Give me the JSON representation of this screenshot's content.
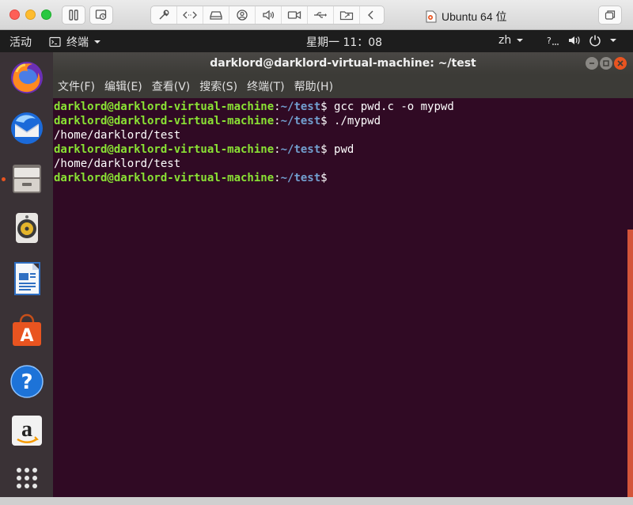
{
  "host": {
    "vm_name": "Ubuntu 64 位",
    "toolbar_icons": [
      "wrench-icon",
      "code-arrows-icon",
      "drive-icon",
      "user-camera-icon",
      "speaker-icon",
      "camera-icon",
      "usb-icon",
      "folder-share-icon",
      "collapse-icon"
    ]
  },
  "topbar": {
    "activities": "活动",
    "app_menu": "终端",
    "clock": "星期一 11：08",
    "input_method": "zh"
  },
  "dock": {
    "apps": [
      "firefox-icon",
      "thunderbird-icon",
      "files-icon",
      "rhythmbox-icon",
      "writer-icon",
      "software-icon",
      "help-icon",
      "amazon-icon",
      "app-grid-icon"
    ]
  },
  "terminal": {
    "title": "darklord@darklord-virtual-machine: ~/test",
    "menus": [
      "文件(F)",
      "编辑(E)",
      "查看(V)",
      "搜索(S)",
      "终端(T)",
      "帮助(H)"
    ],
    "lines": [
      {
        "user": "darklord@darklord-virtual-machine",
        "path": "~/test",
        "cmd": " gcc pwd.c -o mypwd"
      },
      {
        "user": "darklord@darklord-virtual-machine",
        "path": "~/test",
        "cmd": " ./mypwd"
      },
      {
        "output": "/home/darklord/test"
      },
      {
        "user": "darklord@darklord-virtual-machine",
        "path": "~/test",
        "cmd": " pwd"
      },
      {
        "output": "/home/darklord/test"
      },
      {
        "user": "darklord@darklord-virtual-machine",
        "path": "~/test",
        "cmd": ""
      }
    ]
  },
  "colors": {
    "terminal_bg": "#300a24",
    "prompt_user": "#8ae234",
    "prompt_path": "#729fcf",
    "ubuntu_orange": "#e95420"
  }
}
